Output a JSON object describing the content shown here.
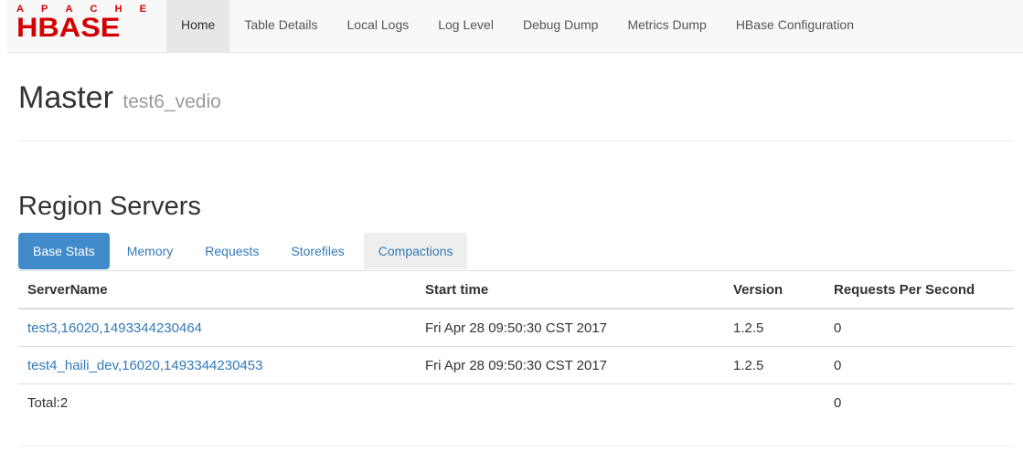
{
  "logo": {
    "top_text": "APACHE",
    "main_text": "HBASE",
    "color": "#d40000"
  },
  "nav": [
    {
      "label": "Home",
      "active": true
    },
    {
      "label": "Table Details"
    },
    {
      "label": "Local Logs"
    },
    {
      "label": "Log Level"
    },
    {
      "label": "Debug Dump"
    },
    {
      "label": "Metrics Dump"
    },
    {
      "label": "HBase Configuration"
    }
  ],
  "header": {
    "title": "Master",
    "subtitle": "test6_vedio"
  },
  "region_servers": {
    "title": "Region Servers",
    "tabs": [
      "Base Stats",
      "Memory",
      "Requests",
      "Storefiles",
      "Compactions"
    ],
    "columns": [
      "ServerName",
      "Start time",
      "Version",
      "Requests Per Second"
    ],
    "rows": [
      {
        "server": "test3,16020,1493344230464",
        "start": "Fri Apr 28 09:50:30 CST 2017",
        "version": "1.2.5",
        "rps": "0"
      },
      {
        "server": "test4_haili_dev,16020,1493344230453",
        "start": "Fri Apr 28 09:50:30 CST 2017",
        "version": "1.2.5",
        "rps": "0"
      }
    ],
    "total": {
      "label": "Total:2",
      "rps": "0"
    }
  },
  "colors": {
    "link": "#337ab7",
    "active_tab": "#428bca"
  }
}
